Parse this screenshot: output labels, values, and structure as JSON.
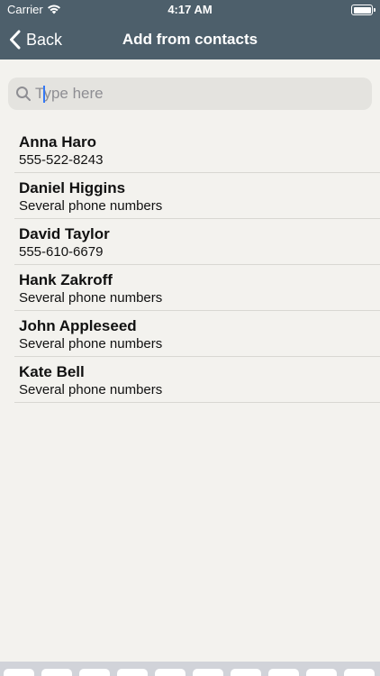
{
  "status_bar": {
    "carrier": "Carrier",
    "time": "4:17 AM"
  },
  "nav": {
    "back_label": "Back",
    "title": "Add from contacts"
  },
  "search": {
    "placeholder": "Type here",
    "value": ""
  },
  "contacts": [
    {
      "name": "Anna Haro",
      "detail": "555-522-8243"
    },
    {
      "name": "Daniel Higgins",
      "detail": "Several phone numbers"
    },
    {
      "name": "David Taylor",
      "detail": "555-610-6679"
    },
    {
      "name": "Hank Zakroff",
      "detail": "Several phone numbers"
    },
    {
      "name": "John Appleseed",
      "detail": "Several phone numbers"
    },
    {
      "name": "Kate Bell",
      "detail": "Several phone numbers"
    }
  ],
  "colors": {
    "nav_background": "#4d5f6b",
    "page_background": "#f3f2ee",
    "search_background": "#e4e3df",
    "caret": "#3478f6"
  }
}
